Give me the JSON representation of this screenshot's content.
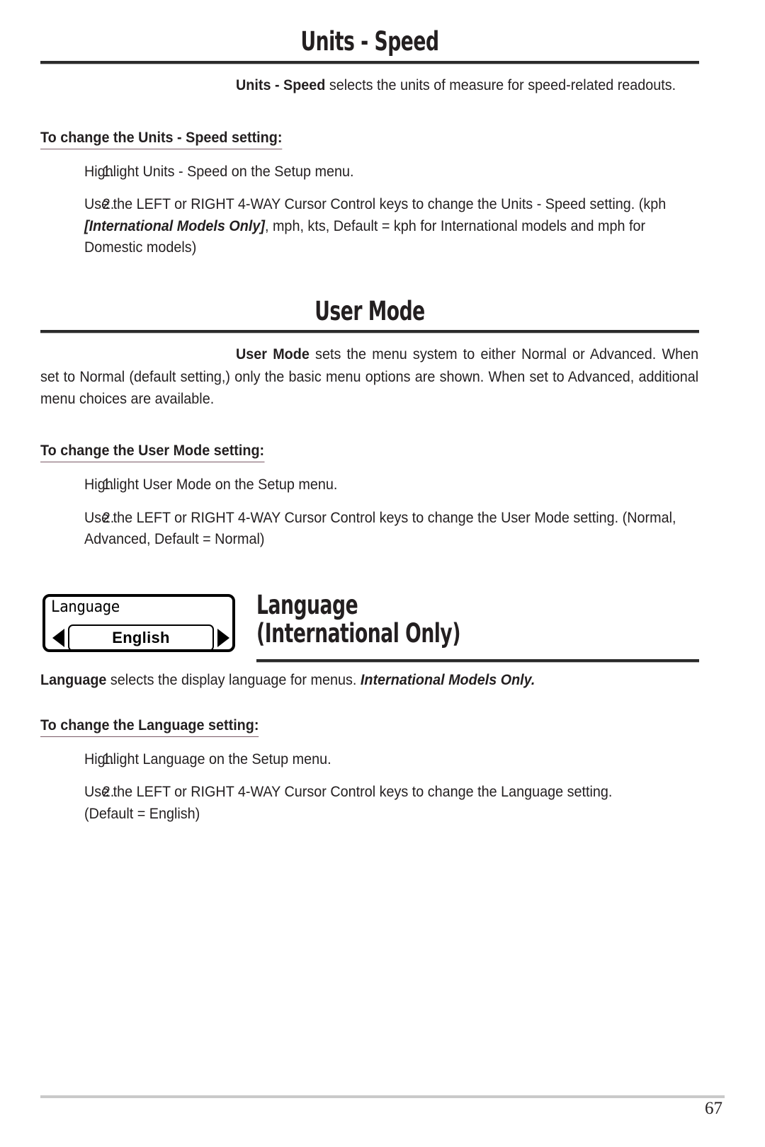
{
  "page": {
    "number": "67"
  },
  "sections": [
    {
      "id": "units-speed",
      "title": "Units - Speed",
      "intro_bold": "Units - Speed",
      "intro_rest": " selects the units of measure for speed-related readouts.",
      "subhead": "To change the Units - Speed setting:",
      "steps": [
        {
          "num": "1.",
          "text": "Highlight Units - Speed on the Setup menu."
        },
        {
          "num": "2.",
          "pre": "Use the LEFT or RIGHT 4-WAY Cursor Control keys to change the Units - Speed setting. (kph ",
          "emph": "[International Models Only]",
          "post": ", mph, kts, Default = kph for International models and mph for Domestic models)"
        }
      ]
    },
    {
      "id": "user-mode",
      "title": "User Mode",
      "intro_bold": "User Mode",
      "intro_rest": " sets the menu system to either Normal or Advanced. When set to Normal (default setting,) only the basic menu options are shown.  When set to Advanced, additional menu choices are available.",
      "subhead": "To change the User Mode setting:",
      "steps": [
        {
          "num": "1.",
          "text": "Highlight User Mode on the Setup menu."
        },
        {
          "num": "2.",
          "text": "Use the LEFT or RIGHT 4-WAY Cursor Control keys to change the User Mode setting. (Normal, Advanced, Default = Normal)"
        }
      ]
    },
    {
      "id": "language",
      "title": "Language",
      "subtitle": "(International Only)",
      "intro_bold": "Language",
      "intro_mid": " selects the display language for menus. ",
      "intro_emph": "International Models Only.",
      "subhead": "To change the Language setting:",
      "steps": [
        {
          "num": "1.",
          "text": "Highlight Language on the Setup menu."
        },
        {
          "num": "2.",
          "pre": "Use the LEFT or RIGHT 4-WAY Cursor Control keys to change the Language setting.",
          "post": "(Default = English)"
        }
      ]
    }
  ],
  "lcd_widget": {
    "menu_title": "Language",
    "selected_value": "English",
    "left_arrow": "left-arrow-icon",
    "right_arrow": "right-arrow-icon"
  }
}
